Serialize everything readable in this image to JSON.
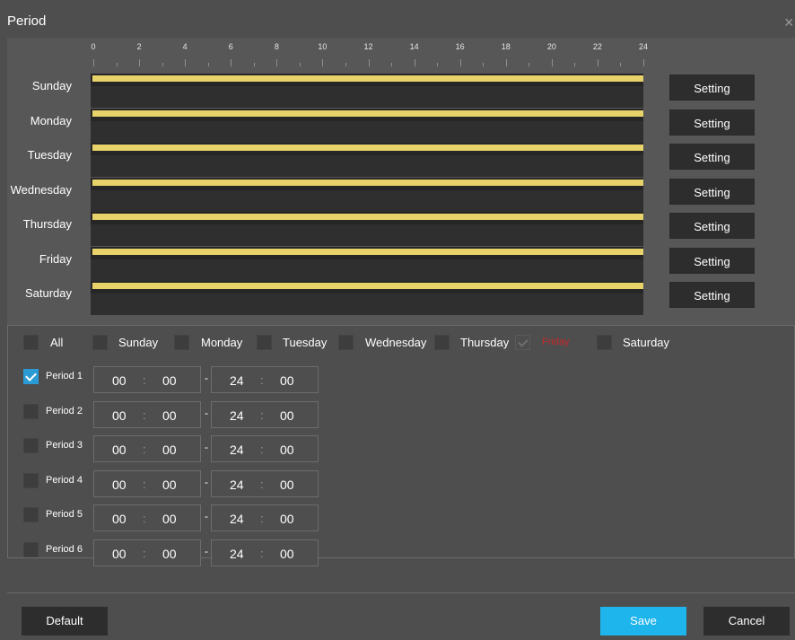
{
  "dialog": {
    "title": "Period",
    "close_glyph": "×"
  },
  "ruler": {
    "ticks": [
      "0",
      "2",
      "4",
      "6",
      "8",
      "10",
      "12",
      "14",
      "16",
      "18",
      "20",
      "22",
      "24"
    ]
  },
  "days": [
    {
      "label": "Sunday",
      "button": "Setting"
    },
    {
      "label": "Monday",
      "button": "Setting"
    },
    {
      "label": "Tuesday",
      "button": "Setting"
    },
    {
      "label": "Wednesday",
      "button": "Setting"
    },
    {
      "label": "Thursday",
      "button": "Setting"
    },
    {
      "label": "Friday",
      "button": "Setting"
    },
    {
      "label": "Saturday",
      "button": "Setting"
    }
  ],
  "copy_to": {
    "all_label": "All",
    "all_checked": false,
    "days": [
      {
        "label": "Sunday",
        "checked": false,
        "disabled": false
      },
      {
        "label": "Monday",
        "checked": false,
        "disabled": false
      },
      {
        "label": "Tuesday",
        "checked": false,
        "disabled": false
      },
      {
        "label": "Wednesday",
        "checked": false,
        "disabled": false
      },
      {
        "label": "Thursday",
        "checked": false,
        "disabled": false
      },
      {
        "label": "Friday",
        "checked": true,
        "disabled": true,
        "current": true
      },
      {
        "label": "Saturday",
        "checked": false,
        "disabled": false
      }
    ]
  },
  "periods": [
    {
      "label": "Period 1",
      "checked": true,
      "start_h": "00",
      "start_m": "00",
      "end_h": "24",
      "end_m": "00"
    },
    {
      "label": "Period 2",
      "checked": false,
      "start_h": "00",
      "start_m": "00",
      "end_h": "24",
      "end_m": "00"
    },
    {
      "label": "Period 3",
      "checked": false,
      "start_h": "00",
      "start_m": "00",
      "end_h": "24",
      "end_m": "00"
    },
    {
      "label": "Period 4",
      "checked": false,
      "start_h": "00",
      "start_m": "00",
      "end_h": "24",
      "end_m": "00"
    },
    {
      "label": "Period 5",
      "checked": false,
      "start_h": "00",
      "start_m": "00",
      "end_h": "24",
      "end_m": "00"
    },
    {
      "label": "Period 6",
      "checked": false,
      "start_h": "00",
      "start_m": "00",
      "end_h": "24",
      "end_m": "00"
    }
  ],
  "time_separators": {
    "colon": ":",
    "dash": "-"
  },
  "footer": {
    "default_label": "Default",
    "save_label": "Save",
    "cancel_label": "Cancel"
  },
  "colors": {
    "schedule_bar": "#e7d36a",
    "save_button": "#1eb4ec",
    "current_day": "#c82828",
    "checkbox_checked": "#2b9bd6"
  }
}
